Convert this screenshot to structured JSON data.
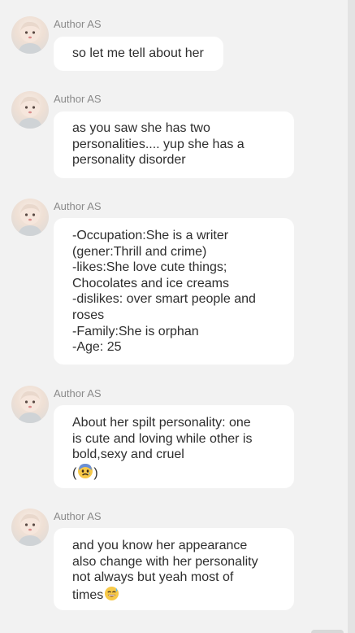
{
  "messages": [
    {
      "author": "Author AS",
      "lines": [
        "so let me tell about her"
      ]
    },
    {
      "author": "Author AS",
      "lines": [
        "as you saw she has two",
        "personalities.... yup she has a",
        "personality disorder"
      ]
    },
    {
      "author": "Author AS",
      "lines": [
        "-Occupation:She is a writer",
        "(gener:Thrill and crime)",
        "-likes:She love cute things;",
        "Chocolates and ice creams",
        "-dislikes: over smart people and",
        "roses",
        "-Family:She is orphan",
        "-Age: 25"
      ]
    },
    {
      "author": "Author AS",
      "lines": [
        "About her spilt personality: one",
        "is cute and loving while other is",
        "bold,sexy and cruel"
      ],
      "emoji_line": {
        "open": "(",
        "close": ")",
        "emoji": "anxious-face-emoji"
      }
    },
    {
      "author": "Author AS",
      "lines": [
        "and you know her appearance",
        "also change with her personality",
        "not always but yeah most of",
        "times"
      ],
      "trailing_emoji": "sweat-smile-emoji"
    }
  ],
  "colors": {
    "background": "#f2f2f2",
    "bubble": "#ffffff",
    "author_text": "#8a8a8a",
    "message_text": "#2e2e2e"
  }
}
